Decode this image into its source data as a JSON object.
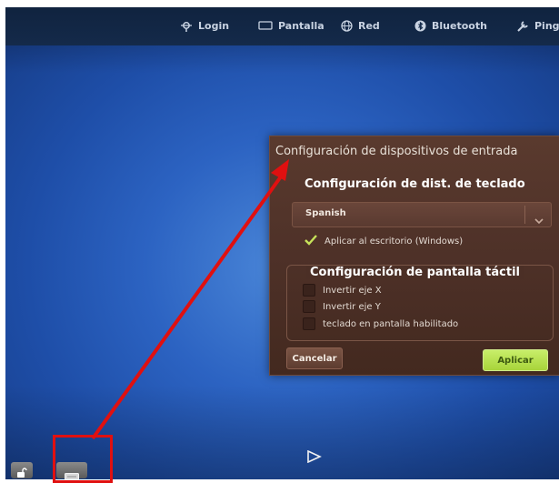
{
  "topbar": {
    "items": [
      {
        "label": "Login",
        "icon": "login-icon"
      },
      {
        "label": "Pantalla",
        "icon": "monitor-icon"
      },
      {
        "label": "Red",
        "icon": "network-icon"
      },
      {
        "label": "Bluetooth",
        "icon": "bluetooth-icon"
      },
      {
        "label": "Ping",
        "icon": "wrench-icon"
      }
    ]
  },
  "dialog": {
    "title": "Configuración de dispositivos de entrada",
    "keyboard": {
      "heading": "Configuración de dist. de teclado",
      "selected_layout": "Spanish",
      "apply_desktop_label": "Aplicar al escritorio (Windows)",
      "apply_desktop_checked": true
    },
    "touch": {
      "heading": "Configuración de pantalla táctil",
      "options": [
        {
          "label": "Invertir eje X",
          "checked": false
        },
        {
          "label": "Invertir eje Y",
          "checked": false
        },
        {
          "label": "teclado en pantalla habilitado",
          "checked": false
        }
      ]
    },
    "cancel_label": "Cancelar",
    "apply_label": "Aplicar"
  },
  "colors": {
    "annotation_red": "#e01010",
    "apply_green": "#b6e04a",
    "dialog_brown": "#4e3128",
    "desktop_blue": "#2c63c2"
  }
}
